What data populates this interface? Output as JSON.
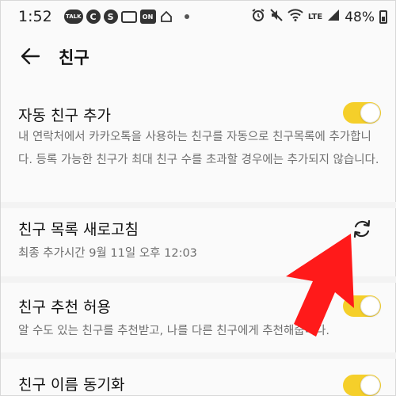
{
  "status_bar": {
    "time": "1:52",
    "notification_icons": [
      "TALK",
      "C",
      "S",
      "box",
      "ON",
      "home"
    ],
    "battery": "48%",
    "network": "LTE"
  },
  "header": {
    "title": "친구"
  },
  "settings": [
    {
      "title": "자동 친구 추가",
      "description": "내 연락처에서 카카오톡을 사용하는 친구를 자동으로 친구목록에 추가합니다. 등록 가능한 친구가 최대 친구 수를 초과할 경우에는 추가되지 않습니다.",
      "control": "toggle",
      "enabled": true
    },
    {
      "title": "친구 목록 새로고침",
      "description": "최종 추가시간 9월 11일 오후 12:03",
      "control": "refresh-icon"
    },
    {
      "title": "친구 추천 허용",
      "description": "알 수도 있는 친구를 추천받고, 나를 다른 친구에게 추천해줍니다.",
      "control": "toggle",
      "enabled": true
    },
    {
      "title": "친구 이름 동기화",
      "control": "toggle",
      "enabled": true
    }
  ],
  "colors": {
    "toggle_on": "#f5cf2a",
    "annotation_arrow": "#ff1a1a"
  }
}
